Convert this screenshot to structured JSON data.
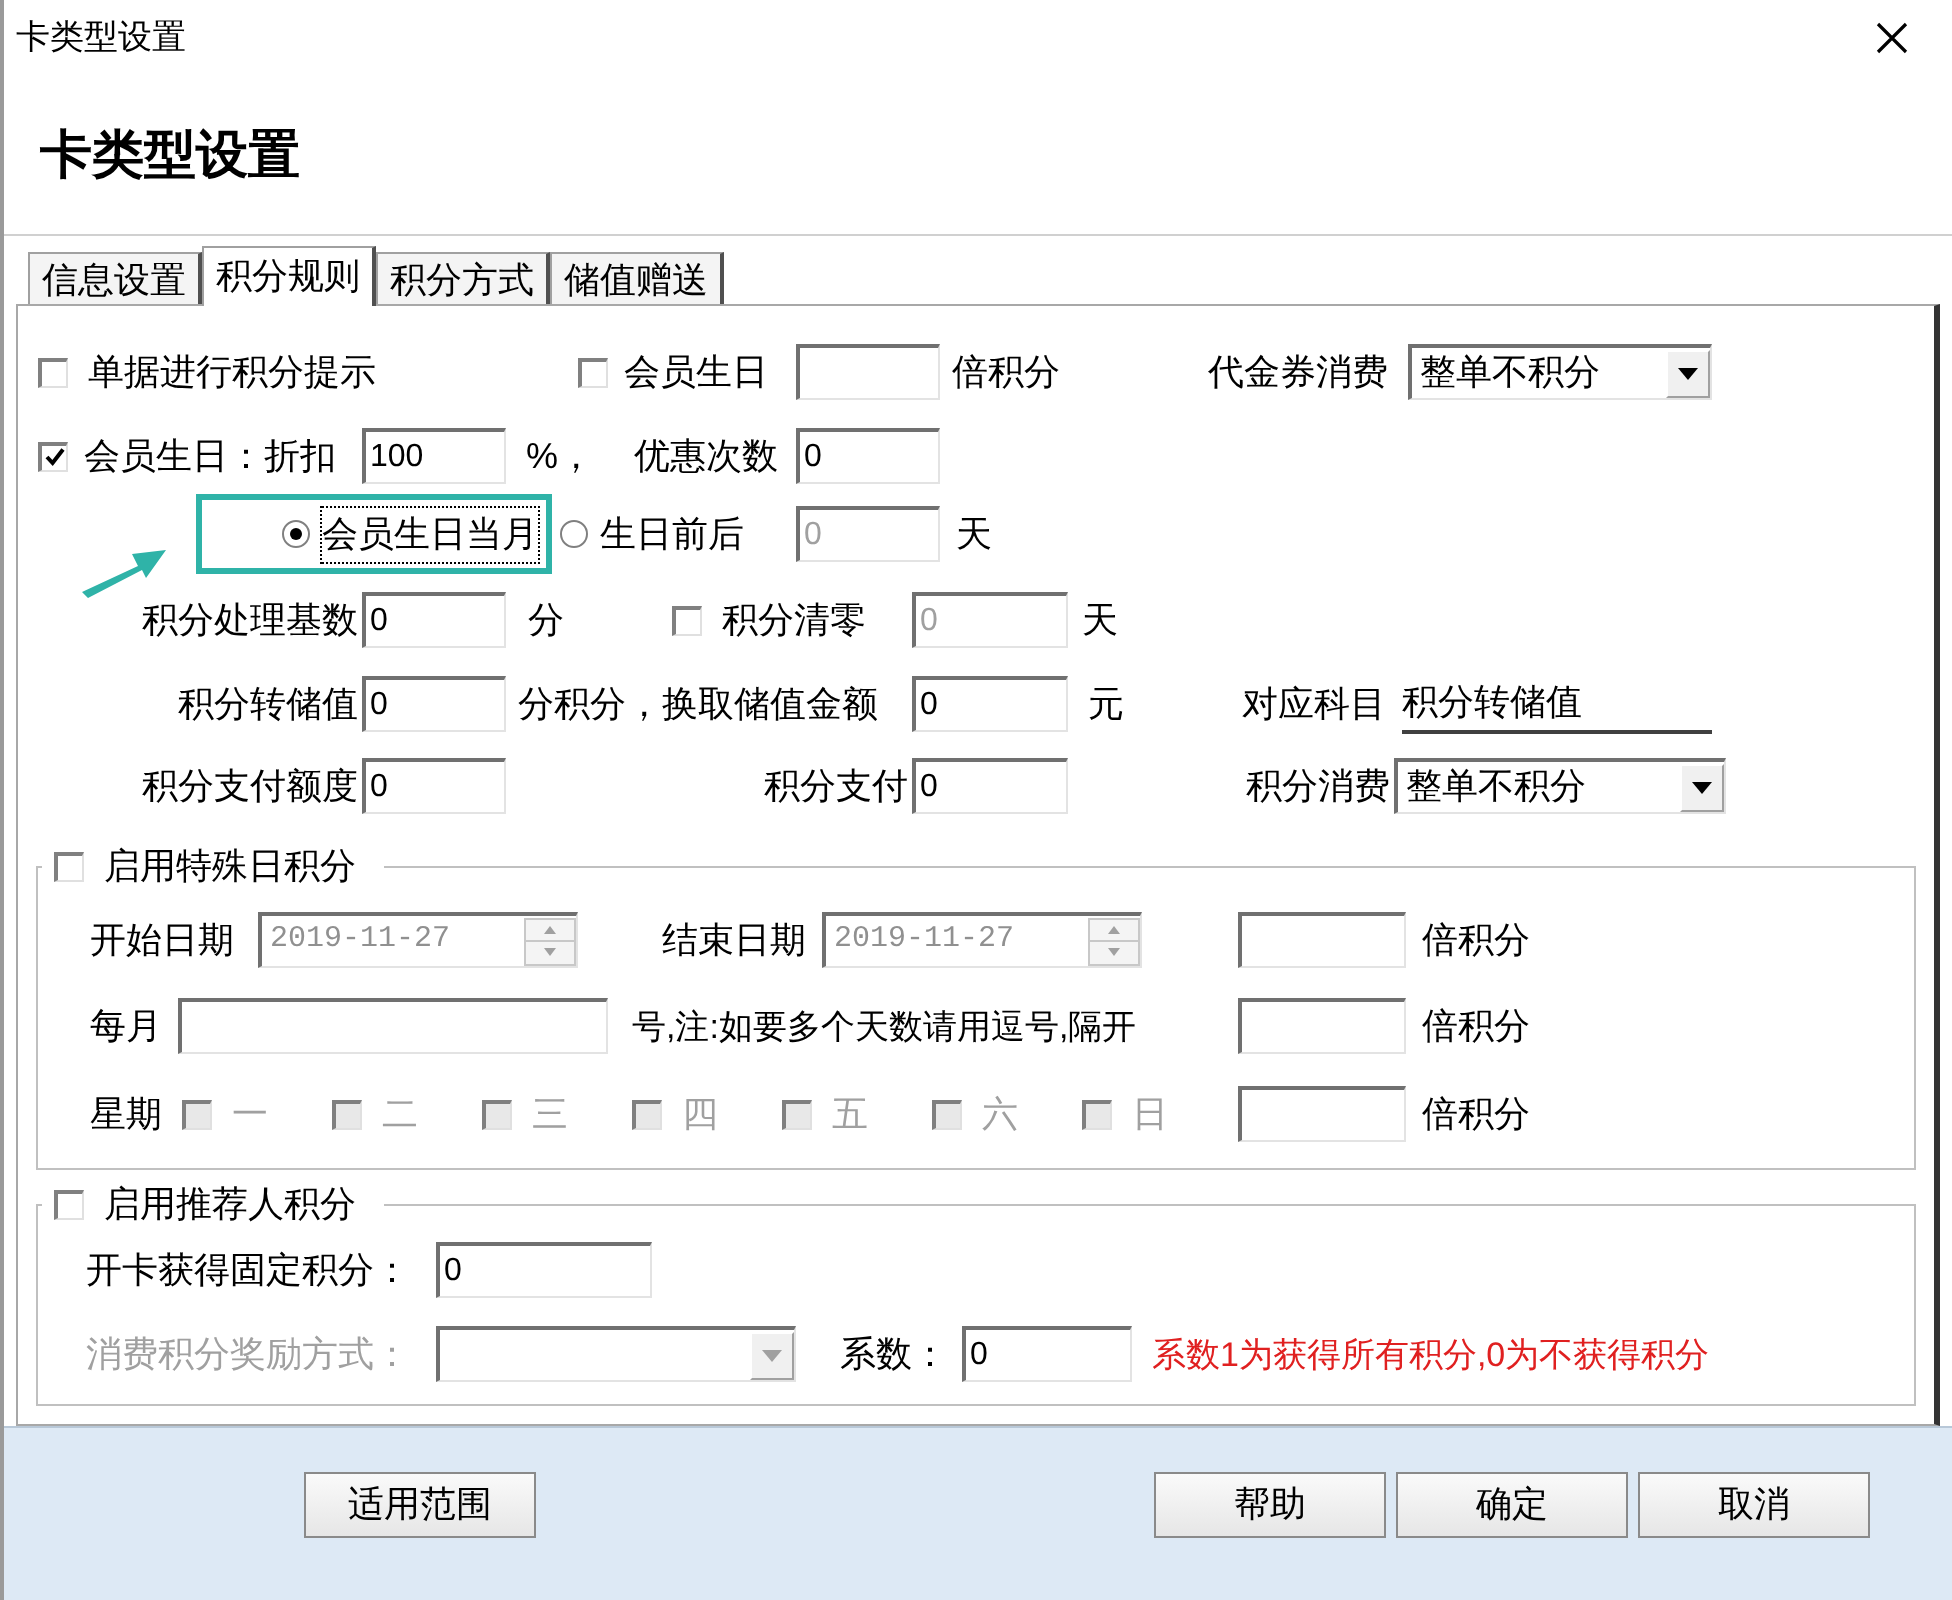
{
  "window": {
    "title": "卡类型设置"
  },
  "header": {
    "title": "卡类型设置"
  },
  "tabs": [
    {
      "label": "信息设置",
      "selected": false
    },
    {
      "label": "积分规则",
      "selected": true
    },
    {
      "label": "积分方式",
      "selected": false
    },
    {
      "label": "储值赠送",
      "selected": false
    }
  ],
  "receipt_points_prompt": {
    "label": "单据进行积分提示",
    "checked": false
  },
  "birthday_multiplier": {
    "label": "会员生日",
    "checked": false,
    "unit": "倍积分"
  },
  "voucher_consumption": {
    "label": "代金券消费",
    "value": "整单不积分"
  },
  "birthday_discount": {
    "label": "会员生日：折扣",
    "checked": true,
    "value": "100",
    "unit": "%，"
  },
  "discount_times": {
    "label": "优惠次数",
    "value": "0"
  },
  "birthday_options": [
    {
      "label": "会员生日当月",
      "selected": true,
      "highlighted": true
    },
    {
      "label": "生日前后",
      "selected": false,
      "highlighted": false
    }
  ],
  "days_around": {
    "value": "0",
    "unit": "天",
    "disabled": true
  },
  "points_base": {
    "label": "积分处理基数",
    "value": "0",
    "unit": "分"
  },
  "points_reset": {
    "label": "积分清零",
    "checked": false,
    "value": "0",
    "unit": "天",
    "disabled": true
  },
  "points_to_balance": {
    "label": "积分转储值",
    "value": "0",
    "unit": "分积分，换取储值金额"
  },
  "balance_amount": {
    "value": "0",
    "unit": "元"
  },
  "account": {
    "label": "对应科目",
    "value": "积分转储值"
  },
  "payment_limit": {
    "label": "积分支付额度",
    "value": "0"
  },
  "points_payment": {
    "label": "积分支付",
    "value": "0"
  },
  "points_consumption": {
    "label": "积分消费",
    "value": "整单不积分"
  },
  "special_days": {
    "label": "启用特殊日积分",
    "checked": false,
    "start": {
      "label": "开始日期",
      "value": "2019-11-27",
      "disabled": true
    },
    "end": {
      "label": "结束日期",
      "value": "2019-11-27",
      "disabled": true
    },
    "date_unit": "倍积分",
    "monthly": {
      "label": "每月",
      "note": "号,注:如要多个天数请用逗号,隔开",
      "unit": "倍积分"
    },
    "weekday_label": "星期",
    "weekdays": [
      {
        "label": "一",
        "checked": false,
        "disabled": true
      },
      {
        "label": "二",
        "checked": false,
        "disabled": true
      },
      {
        "label": "三",
        "checked": false,
        "disabled": true
      },
      {
        "label": "四",
        "checked": false,
        "disabled": true
      },
      {
        "label": "五",
        "checked": false,
        "disabled": true
      },
      {
        "label": "六",
        "checked": false,
        "disabled": true
      },
      {
        "label": "日",
        "checked": false,
        "disabled": true
      }
    ],
    "weekday_unit": "倍积分"
  },
  "referrer": {
    "label": "启用推荐人积分",
    "checked": false,
    "fixed_points": {
      "label": "开卡获得固定积分：",
      "value": "0"
    },
    "reward_mode": {
      "label": "消费积分奖励方式：",
      "disabled": true
    },
    "coefficient": {
      "label": "系数：",
      "value": "0"
    },
    "note": "系数1为获得所有积分,0为不获得积分"
  },
  "buttons": [
    {
      "label": "适用范围"
    },
    {
      "label": "帮助"
    },
    {
      "label": "确定"
    },
    {
      "label": "取消"
    }
  ]
}
